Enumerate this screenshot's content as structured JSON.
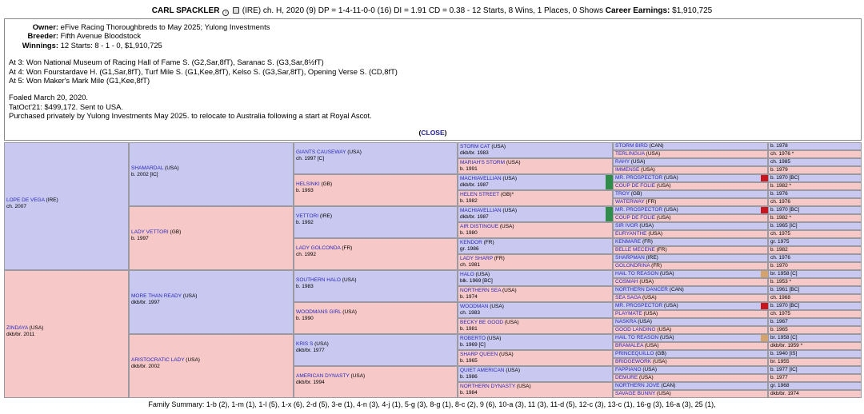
{
  "header": {
    "horse_name": "CARL SPACKLER",
    "info_icon": "info-icon",
    "doc_icon": "document-icon",
    "details": "(IRE) ch. H, 2020 (9) DP = 1-4-11-0-0 (16) DI = 1.91   CD = 0.38 - 12 Starts, 8 Wins, 1 Places, 0 Shows",
    "earnings_label": "Career Earnings:",
    "earnings_value": "$1,910,725"
  },
  "info": {
    "owner_label": "Owner:",
    "owner": "eFive Racing Thoroughbreds to May 2025; Yulong Investments",
    "breeder_label": "Breeder:",
    "breeder": "Fifth Avenue Bloodstock",
    "winnings_label": "Winnings:",
    "winnings": "12 Starts: 8 - 1 - 0, $1,910,725",
    "wins": [
      "At 3: Won National Museum of Racing Hall of Fame S. (G2,Sar,8fT), Saranac S. (G3,Sar,8½fT)",
      "At 4: Won Fourstardave H. (G1,Sar,8fT), Turf Mile S. (G1,Kee,8fT), Kelso S. (G3,Sar,8fT), Opening Verse S. (CD,8fT)",
      "At 5: Won Maker's Mark Mile (G1,Kee,8fT)"
    ],
    "notes": [
      "Foaled March 20, 2020.",
      "TatOct'21: $499,172. Sent to USA.",
      "Purchased privately by Yulong Investments May 2025. to relocate to Australia following a start at Royal Ascot."
    ],
    "close_label": "CLOSE"
  },
  "pedigree": {
    "gen1": [
      {
        "name": "LOPE DE VEGA",
        "country": "(IRE)",
        "detail": "ch. 2007"
      },
      {
        "name": "ZINDAYA",
        "country": "(USA)",
        "detail": "dkb/br. 2011"
      }
    ],
    "gen2": [
      {
        "name": "SHAMARDAL",
        "country": "(USA)",
        "detail": "b. 2002 [IC]"
      },
      {
        "name": "LADY VETTORI",
        "country": "(GB)",
        "detail": "b. 1997"
      },
      {
        "name": "MORE THAN READY",
        "country": "(USA)",
        "detail": "dkb/br. 1997"
      },
      {
        "name": "ARISTOCRATIC LADY",
        "country": "(USA)",
        "detail": "dkb/br. 2002"
      }
    ],
    "gen3": [
      {
        "name": "GIANTS CAUSEWAY",
        "country": "(USA)",
        "detail": "ch. 1997 [C]"
      },
      {
        "name": "HELSINKI",
        "country": "(GB)",
        "detail": "b. 1993"
      },
      {
        "name": "VETTORI",
        "country": "(IRE)",
        "detail": "b. 1992"
      },
      {
        "name": "LADY GOLCONDA",
        "country": "(FR)",
        "detail": "ch. 1992"
      },
      {
        "name": "SOUTHERN HALO",
        "country": "(USA)",
        "detail": "b. 1983"
      },
      {
        "name": "WOODMANS GIRL",
        "country": "(USA)",
        "detail": "b. 1990"
      },
      {
        "name": "KRIS S",
        "country": "(USA)",
        "detail": "dkb/br. 1977"
      },
      {
        "name": "AMERICAN DYNASTY",
        "country": "(USA)",
        "detail": "dkb/br. 1994"
      }
    ],
    "gen4": [
      {
        "name": "STORM CAT",
        "country": "(USA)",
        "detail": "dkb/br. 1983"
      },
      {
        "name": "MARIAH'S STORM",
        "country": "(USA)",
        "detail": "b. 1991"
      },
      {
        "name": "MACHIAVELLIAN",
        "country": "(USA)",
        "detail": "dkb/br. 1987"
      },
      {
        "name": "HELEN STREET",
        "country": "(GB)",
        "detail": "b. 1982",
        "mark": "*"
      },
      {
        "name": "MACHIAVELLIAN",
        "country": "(USA)",
        "detail": "dkb/br. 1987"
      },
      {
        "name": "AIR DISTINGUE",
        "country": "(USA)",
        "detail": "b. 1980"
      },
      {
        "name": "KENDOR",
        "country": "(FR)",
        "detail": "gr. 1986"
      },
      {
        "name": "LADY SHARP",
        "country": "(FR)",
        "detail": "ch. 1981"
      },
      {
        "name": "HALO",
        "country": "(USA)",
        "detail": "blk. 1969 [BC]"
      },
      {
        "name": "NORTHERN SEA",
        "country": "(USA)",
        "detail": "b. 1974"
      },
      {
        "name": "WOODMAN",
        "country": "(USA)",
        "detail": "ch. 1983"
      },
      {
        "name": "BECKY BE GOOD",
        "country": "(USA)",
        "detail": "b. 1981"
      },
      {
        "name": "ROBERTO",
        "country": "(USA)",
        "detail": "b. 1969 [C]"
      },
      {
        "name": "SHARP QUEEN",
        "country": "(USA)",
        "detail": "b. 1965"
      },
      {
        "name": "QUIET AMERICAN",
        "country": "(USA)",
        "detail": "b. 1986"
      },
      {
        "name": "NORTHERN DYNASTY",
        "country": "(USA)",
        "detail": "b. 1984"
      }
    ],
    "gen5": [
      {
        "name": "STORM BIRD",
        "country": "(CAN)",
        "year": "b. 1978"
      },
      {
        "name": "TERLINGUA",
        "country": "(USA)",
        "year": "ch. 1976 *"
      },
      {
        "name": "RAHY",
        "country": "(USA)",
        "year": "ch. 1985"
      },
      {
        "name": "IMMENSE",
        "country": "(USA)",
        "year": "b. 1979"
      },
      {
        "name": "MR. PROSPECTOR",
        "country": "(USA)",
        "year": "b. 1970 [BC]"
      },
      {
        "name": "COUP DE FOLIE",
        "country": "(USA)",
        "year": "b. 1982 *"
      },
      {
        "name": "TROY",
        "country": "(GB)",
        "year": "b. 1976"
      },
      {
        "name": "WATERWAY",
        "country": "(FR)",
        "year": "ch. 1976"
      },
      {
        "name": "MR. PROSPECTOR",
        "country": "(USA)",
        "year": "b. 1970 [BC]"
      },
      {
        "name": "COUP DE FOLIE",
        "country": "(USA)",
        "year": "b. 1982 *"
      },
      {
        "name": "SIR IVOR",
        "country": "(USA)",
        "year": "b. 1965 [IC]"
      },
      {
        "name": "EURYANTHE",
        "country": "(USA)",
        "year": "ch. 1975"
      },
      {
        "name": "KENMARE",
        "country": "(FR)",
        "year": "gr. 1975"
      },
      {
        "name": "BELLE MECENE",
        "country": "(FR)",
        "year": "b. 1982"
      },
      {
        "name": "SHARPMAN",
        "country": "(IRE)",
        "year": "ch. 1976"
      },
      {
        "name": "GOLONDRINA",
        "country": "(FR)",
        "year": "b. 1970"
      },
      {
        "name": "HAIL TO REASON",
        "country": "(USA)",
        "year": "br. 1958 [C]"
      },
      {
        "name": "COSMAH",
        "country": "(USA)",
        "year": "b. 1953 *"
      },
      {
        "name": "NORTHERN DANCER",
        "country": "(CAN)",
        "year": "b. 1961 [BC]"
      },
      {
        "name": "SEA SAGA",
        "country": "(USA)",
        "year": "ch. 1968"
      },
      {
        "name": "MR. PROSPECTOR",
        "country": "(USA)",
        "year": "b. 1970 [BC]"
      },
      {
        "name": "PLAYMATE",
        "country": "(USA)",
        "year": "ch. 1975"
      },
      {
        "name": "NASKRA",
        "country": "(USA)",
        "year": "b. 1967"
      },
      {
        "name": "GOOD LANDING",
        "country": "(USA)",
        "year": "b. 1965"
      },
      {
        "name": "HAIL TO REASON",
        "country": "(USA)",
        "year": "br. 1958 [C]"
      },
      {
        "name": "BRAMALEA",
        "country": "(USA)",
        "year": "dkb/br. 1959 *"
      },
      {
        "name": "PRINCEQUILLO",
        "country": "(GB)",
        "year": "b. 1940 [IS]"
      },
      {
        "name": "BRIDGEWORK",
        "country": "(USA)",
        "year": "br. 1955"
      },
      {
        "name": "FAPPIANO",
        "country": "(USA)",
        "year": "b. 1977 [IC]"
      },
      {
        "name": "DEMURE",
        "country": "(USA)",
        "year": "b. 1977"
      },
      {
        "name": "NORTHERN JOVE",
        "country": "(CAN)",
        "year": "gr. 1968"
      },
      {
        "name": "SAVAGE BUNNY",
        "country": "(USA)",
        "year": "dkb/br. 1974"
      }
    ],
    "colors": {
      "male": "#c8c8f0",
      "female": "#f6c8c8",
      "link": "#2a2ab8",
      "marker_green": "#2f8c4a",
      "marker_red": "#c8161f",
      "marker_tan": "#d4a36c"
    }
  },
  "family_summary": "Family Summary: 1-b (2), 1-m (1), 1-l (5), 1-x (6), 2-d (5), 3-e (1), 4-n (3), 4-j (1), 5-g (3), 8-g (1), 8-c (2), 9 (6), 10-a (3), 11 (3), 11-d (5), 12-c (3), 13-c (1), 16-g (3), 16-a (3), 25 (1),"
}
